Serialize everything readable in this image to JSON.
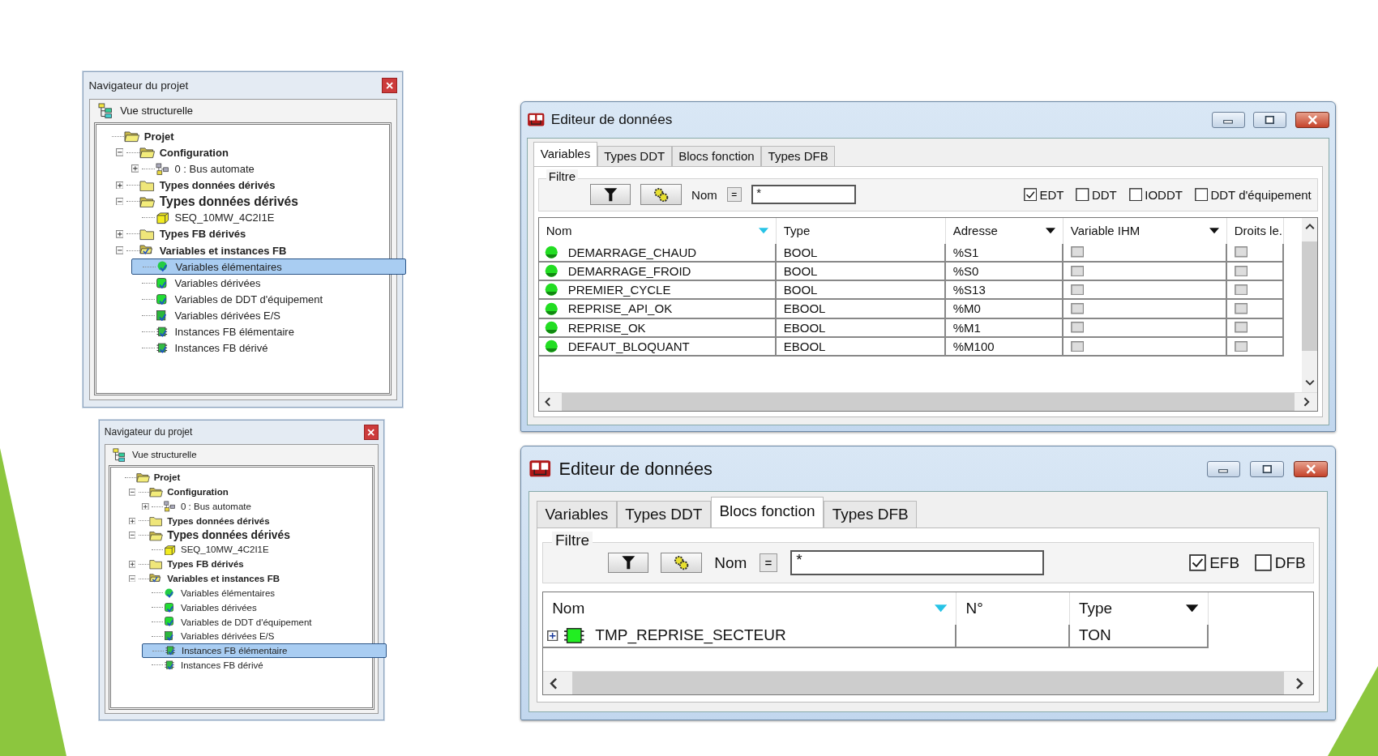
{
  "navigators": [
    {
      "title": "Navigateur du projet",
      "view_label": "Vue structurelle",
      "tree": [
        {
          "label": "Projet",
          "kind": "folder-open",
          "selected": false,
          "children": [
            {
              "label": "Configuration",
              "kind": "folder-open",
              "expanded": true,
              "selected": false,
              "children": [
                {
                  "label": "0 : Bus automate",
                  "kind": "network",
                  "expanded": false,
                  "selected": false
                }
              ]
            },
            {
              "label": "Types données dérivés",
              "kind": "folder",
              "expanded": false,
              "selected": false
            },
            {
              "label": "Types données dérivés",
              "kind": "folder-open",
              "expanded": true,
              "enlarged": true,
              "selected": false,
              "children": [
                {
                  "label": "SEQ_10MW_4C2I1E",
                  "kind": "cube",
                  "selected": false
                }
              ]
            },
            {
              "label": "Types FB dérivés",
              "kind": "folder",
              "expanded": false,
              "selected": false
            },
            {
              "label": "Variables et instances FB",
              "kind": "folder-vars",
              "expanded": true,
              "selected": false,
              "children": [
                {
                  "label": "Variables élémentaires",
                  "kind": "var-circle",
                  "selected": true
                },
                {
                  "label": "Variables dérivées",
                  "kind": "var-square",
                  "selected": false
                },
                {
                  "label": "Variables de DDT d'équipement",
                  "kind": "var-square",
                  "selected": false
                },
                {
                  "label": "Variables dérivées E/S",
                  "kind": "var-io",
                  "selected": false
                },
                {
                  "label": "Instances FB élémentaire",
                  "kind": "fb-chip",
                  "selected": false
                },
                {
                  "label": "Instances FB dérivé",
                  "kind": "fb-chip",
                  "selected": false
                }
              ]
            }
          ]
        }
      ]
    },
    {
      "title": "Navigateur du projet",
      "view_label": "Vue structurelle",
      "tree": [
        {
          "label": "Projet",
          "kind": "folder-open",
          "selected": false,
          "children": [
            {
              "label": "Configuration",
              "kind": "folder-open",
              "expanded": true,
              "selected": false,
              "children": [
                {
                  "label": "0 : Bus automate",
                  "kind": "network",
                  "expanded": false,
                  "selected": false
                }
              ]
            },
            {
              "label": "Types données dérivés",
              "kind": "folder",
              "expanded": false,
              "selected": false
            },
            {
              "label": "Types données dérivés",
              "kind": "folder-open",
              "expanded": true,
              "enlarged": true,
              "selected": false,
              "children": [
                {
                  "label": "SEQ_10MW_4C2I1E",
                  "kind": "cube",
                  "selected": false
                }
              ]
            },
            {
              "label": "Types FB dérivés",
              "kind": "folder",
              "expanded": false,
              "selected": false
            },
            {
              "label": "Variables et instances FB",
              "kind": "folder-vars",
              "expanded": true,
              "selected": false,
              "children": [
                {
                  "label": "Variables élémentaires",
                  "kind": "var-circle",
                  "selected": false
                },
                {
                  "label": "Variables dérivées",
                  "kind": "var-square",
                  "selected": false
                },
                {
                  "label": "Variables de DDT d'équipement",
                  "kind": "var-square",
                  "selected": false
                },
                {
                  "label": "Variables dérivées E/S",
                  "kind": "var-io",
                  "selected": false
                },
                {
                  "label": "Instances FB élémentaire",
                  "kind": "fb-chip",
                  "selected": true
                },
                {
                  "label": "Instances FB dérivé",
                  "kind": "fb-chip",
                  "selected": false
                }
              ]
            }
          ]
        }
      ]
    }
  ],
  "editors": [
    {
      "title": "Editeur de données",
      "tabs": [
        {
          "label": "Variables",
          "selected": true
        },
        {
          "label": "Types DDT",
          "selected": false
        },
        {
          "label": "Blocs fonction",
          "selected": false
        },
        {
          "label": "Types DFB",
          "selected": false
        }
      ],
      "filter": {
        "label": "Filtre",
        "name_label": "Nom",
        "operator": "=",
        "value": "*",
        "checkboxes": [
          {
            "label": "EDT",
            "checked": true
          },
          {
            "label": "DDT",
            "checked": false
          },
          {
            "label": "IODDT",
            "checked": false
          },
          {
            "label": "DDT d'équipement",
            "checked": false
          }
        ]
      },
      "columns": [
        {
          "label": "Nom",
          "kind": "sort"
        },
        {
          "label": "Type",
          "kind": "plain"
        },
        {
          "label": "Adresse",
          "kind": "menu"
        },
        {
          "label": "Variable IHM",
          "kind": "menu"
        },
        {
          "label": "Droits le.",
          "kind": "plain"
        }
      ],
      "rows": [
        {
          "kind": "variable",
          "cells": [
            {
              "text": "DEMARRAGE_CHAUD"
            },
            {
              "text": "BOOL"
            },
            {
              "text": "%S1"
            },
            {
              "checked": false
            },
            {
              "checked": false
            }
          ]
        },
        {
          "kind": "variable",
          "cells": [
            {
              "text": "DEMARRAGE_FROID"
            },
            {
              "text": "BOOL"
            },
            {
              "text": "%S0"
            },
            {
              "checked": false
            },
            {
              "checked": false
            }
          ]
        },
        {
          "kind": "variable",
          "cells": [
            {
              "text": "PREMIER_CYCLE"
            },
            {
              "text": "BOOL"
            },
            {
              "text": "%S13"
            },
            {
              "checked": false
            },
            {
              "checked": false
            }
          ]
        },
        {
          "kind": "variable",
          "cells": [
            {
              "text": "REPRISE_API_OK"
            },
            {
              "text": "EBOOL"
            },
            {
              "text": "%M0"
            },
            {
              "checked": false
            },
            {
              "checked": false
            }
          ]
        },
        {
          "kind": "variable",
          "cells": [
            {
              "text": "REPRISE_OK"
            },
            {
              "text": "EBOOL"
            },
            {
              "text": "%M1"
            },
            {
              "checked": false
            },
            {
              "checked": false
            }
          ]
        },
        {
          "kind": "variable",
          "cells": [
            {
              "text": "DEFAUT_BLOQUANT"
            },
            {
              "text": "EBOOL"
            },
            {
              "text": "%M100"
            },
            {
              "checked": false
            },
            {
              "checked": false
            }
          ]
        }
      ]
    },
    {
      "title": "Editeur de données",
      "tabs": [
        {
          "label": "Variables",
          "selected": false
        },
        {
          "label": "Types DDT",
          "selected": false
        },
        {
          "label": "Blocs fonction",
          "selected": true
        },
        {
          "label": "Types DFB",
          "selected": false
        }
      ],
      "filter": {
        "label": "Filtre",
        "name_label": "Nom",
        "operator": "=",
        "value": "*",
        "checkboxes": [
          {
            "label": "EFB",
            "checked": true
          },
          {
            "label": "DFB",
            "checked": false
          }
        ]
      },
      "columns": [
        {
          "label": "Nom",
          "kind": "sort"
        },
        {
          "label": "N°",
          "kind": "plain"
        },
        {
          "label": "Type",
          "kind": "menu"
        }
      ],
      "rows": [
        {
          "kind": "block",
          "expanded": false,
          "cells": [
            {
              "text": "TMP_REPRISE_SECTEUR"
            },
            {},
            {
              "text": "TON"
            }
          ]
        }
      ]
    }
  ]
}
